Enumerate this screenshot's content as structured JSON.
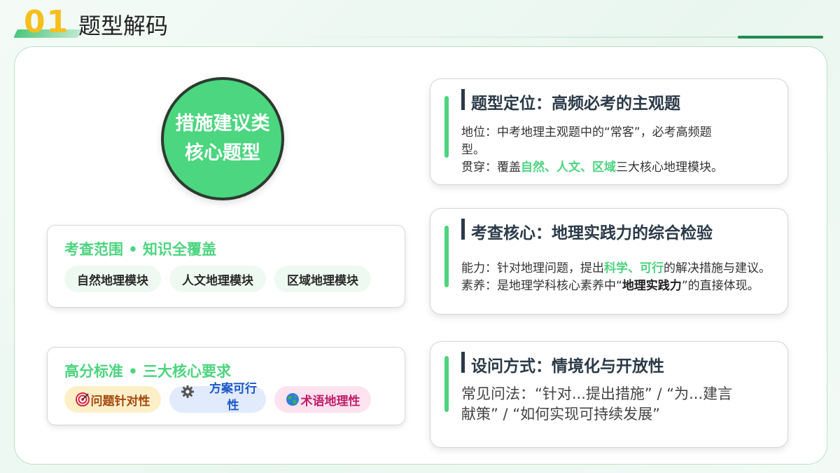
{
  "header": {
    "number": "01",
    "title": "题型解码"
  },
  "circle": {
    "line1": "措施建议类",
    "line2": "核心题型"
  },
  "scope_card": {
    "title": "考查范围 • 知识全覆盖",
    "modules": [
      "自然地理模块",
      "人文地理模块",
      "区域地理模块"
    ]
  },
  "standard_card": {
    "title": "高分标准 • 三大核心要求",
    "tags": [
      {
        "icon": "target-icon",
        "label": "问题针对性",
        "color": "#a2470f"
      },
      {
        "icon": "gear-icon",
        "label_line1": "方案可行",
        "label_line2": "性",
        "color": "#1b57c9"
      },
      {
        "icon": "globe-icon",
        "label": "术语地理性",
        "color": "#c01f6b"
      }
    ]
  },
  "cards": {
    "position": {
      "title": "题型定位：高频必考的主观题",
      "line1": "地位：中考地理主观题中的“常客”，必考高频题",
      "line2": "型。",
      "line3_prefix": "贯穿：覆盖",
      "line3_highlight": "自然、人文、区域",
      "line3_suffix": "三大核心地理模块。"
    },
    "core": {
      "title": "考查核心：地理实践力的综合检验",
      "line1_prefix": "能力：针对地理问题，提出",
      "line1_highlight": "科学、可行",
      "line1_suffix": "的解决措施与建议。",
      "line2_prefix": "素养：是地理学科核心素养中“",
      "line2_bold": "地理实践力",
      "line2_suffix": "”的直接体现。"
    },
    "question": {
      "title": "设问方式：情境化与开放性",
      "line1": "常见问法：“针对...提出措施” / “为...建言",
      "line2": "献策” / “如何实现可持续发展”"
    }
  },
  "colors": {
    "accent_green": "#4cd47f",
    "number_yellow": "#f6bf1d",
    "dark_title": "#2b3a48"
  }
}
